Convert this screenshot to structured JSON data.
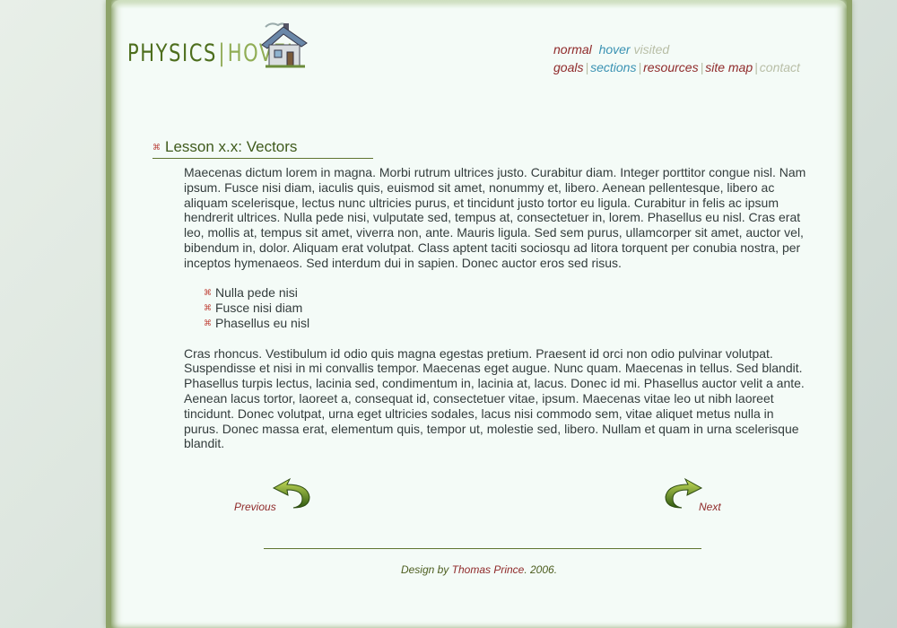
{
  "site": {
    "logo_word1": "PHYSICS",
    "logo_separator": "|",
    "logo_word2": "HOVEL"
  },
  "nav": {
    "legend": {
      "normal": "normal",
      "hover": "hover",
      "visited": "visited"
    },
    "links": [
      {
        "label": "goals"
      },
      {
        "label": "sections"
      },
      {
        "label": "resources"
      },
      {
        "label": "site map"
      },
      {
        "label": "contact"
      }
    ],
    "separator": "|"
  },
  "lesson": {
    "title": "Lesson x.x: Vectors",
    "paragraph1": "Maecenas dictum lorem in magna. Morbi rutrum ultrices justo. Curabitur diam. Integer porttitor congue nisl. Nam ipsum. Fusce nisi diam, iaculis quis, euismod sit amet, nonummy et, libero. Aenean pellentesque, libero ac aliquam scelerisque, lectus nunc ultricies purus, et tincidunt justo tortor eu ligula. Curabitur in felis ac ipsum hendrerit ultrices. Nulla pede nisi, vulputate sed, tempus at, consectetuer in, lorem. Phasellus eu nisl. Cras erat leo, mollis at, tempus sit amet, viverra non, ante. Mauris ligula. Sed sem purus, ullamcorper sit amet, auctor vel, bibendum in, dolor. Aliquam erat volutpat. Class aptent taciti sociosqu ad litora torquent per conubia nostra, per inceptos hymenaeos. Sed interdum dui in sapien. Donec auctor eros sed risus.",
    "list": [
      "Nulla pede nisi",
      "Fusce nisi diam",
      "Phasellus eu nisl"
    ],
    "paragraph2": "Cras rhoncus. Vestibulum id odio quis magna egestas pretium. Praesent id orci non odio pulvinar volutpat. Suspendisse et nisi in mi convallis tempor. Maecenas eget augue. Nunc quam. Maecenas in tellus. Sed blandit. Phasellus turpis lectus, lacinia sed, condimentum in, lacinia at, lacus. Donec id mi. Phasellus auctor velit a ante. Aenean lacus tortor, laoreet a, consequat id, consectetuer vitae, ipsum. Maecenas vitae leo ut nibh laoreet tincidunt. Donec volutpat, urna eget ultricies sodales, lacus nisi commodo sem, vitae aliquet metus nulla in purus. Donec massa erat, elementum quis, tempor ut, molestie sed, libero. Nullam et quam in urna scelerisque blandit."
  },
  "pager": {
    "previous": "Previous",
    "next": "Next"
  },
  "footer": {
    "prefix": "Design by ",
    "author": "Thomas Prince",
    "suffix": ". 2006."
  },
  "colors": {
    "accent_green": "#5f7430",
    "link_red": "#8f2a2a",
    "hover_blue": "#3a92b3",
    "visited_grey": "#b8bea6"
  }
}
